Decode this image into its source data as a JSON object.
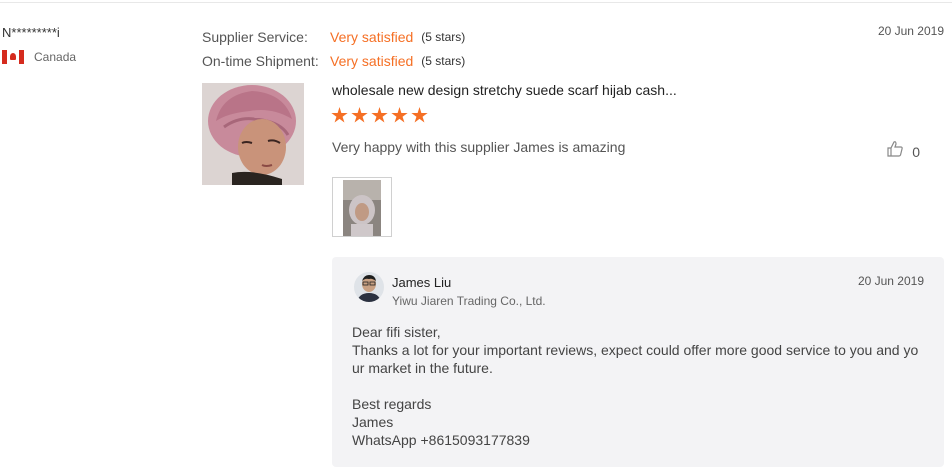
{
  "reviewer": {
    "name": "N*********i",
    "country": "Canada",
    "flag_icon": "canada-flag-icon"
  },
  "ratings": [
    {
      "label": "Supplier Service:",
      "value": "Very satisfied",
      "stars_text": "(5 stars)"
    },
    {
      "label": "On-time Shipment:",
      "value": "Very satisfied",
      "stars_text": "(5 stars)"
    }
  ],
  "review": {
    "date": "20 Jun 2019",
    "product_title": "wholesale new design stretchy suede scarf hijab cash...",
    "rating": 5,
    "comment": "Very happy with this supplier James is amazing",
    "likes": "0"
  },
  "reply": {
    "name": "James Liu",
    "company": "Yiwu Jiaren Trading Co., Ltd.",
    "date": "20 Jun 2019",
    "lines": [
      "Dear fifi sister,",
      "Thanks a lot for your important reviews, expect could offer more good service to you and yo",
      "ur market in the future.",
      "",
      "Best regards",
      "James",
      "WhatsApp +8615093177839"
    ]
  },
  "colors": {
    "accent": "#f56f24",
    "reply_bg": "#f3f3f5"
  }
}
